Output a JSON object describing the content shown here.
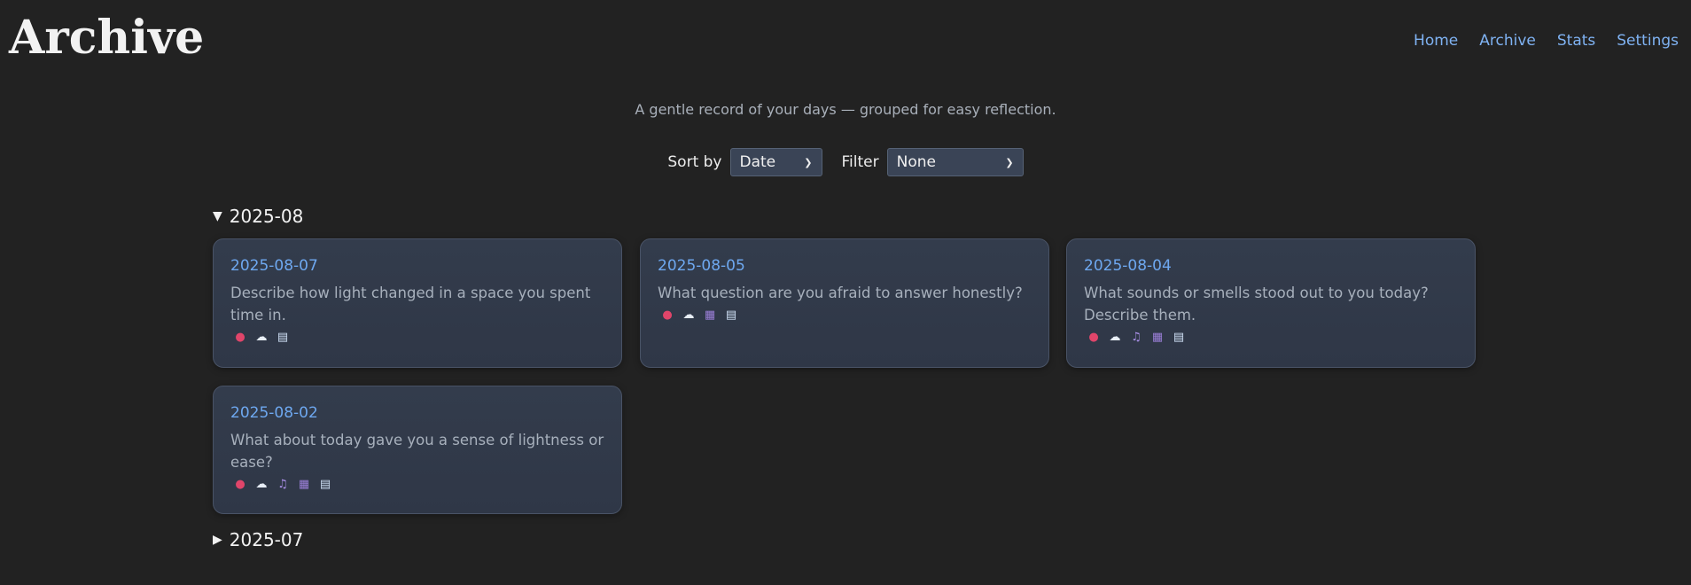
{
  "header": {
    "title": "Archive",
    "nav": [
      "Home",
      "Archive",
      "Stats",
      "Settings"
    ]
  },
  "subtitle": "A gentle record of your days — grouped for easy reflection.",
  "controls": {
    "sort_label": "Sort by",
    "sort_value": "Date",
    "filter_label": "Filter",
    "filter_value": "None"
  },
  "groups": [
    {
      "label": "2025-08",
      "expanded": true,
      "entries": [
        {
          "date": "2025-08-07",
          "prompt": "Describe how light changed in a space you spent time in.",
          "icons": [
            "pin-icon",
            "cloud-icon",
            "book-icon"
          ]
        },
        {
          "date": "2025-08-05",
          "prompt": "What question are you afraid to answer honestly?",
          "icons": [
            "pin-icon",
            "cloud-icon",
            "film-icon",
            "book-icon"
          ]
        },
        {
          "date": "2025-08-04",
          "prompt": "What sounds or smells stood out to you today? Describe them.",
          "icons": [
            "pin-icon",
            "cloud-icon",
            "music-icon",
            "film-icon",
            "book-icon"
          ]
        },
        {
          "date": "2025-08-02",
          "prompt": "What about today gave you a sense of lightness or ease?",
          "icons": [
            "pin-icon",
            "cloud-icon",
            "music-icon",
            "film-icon",
            "book-icon"
          ]
        }
      ]
    },
    {
      "label": "2025-07",
      "expanded": false,
      "entries": []
    }
  ],
  "colors": {
    "background": "#222222",
    "accent_link": "#7fb2f2",
    "card_date": "#6ea8f0",
    "card_bg": "#333c4c"
  }
}
